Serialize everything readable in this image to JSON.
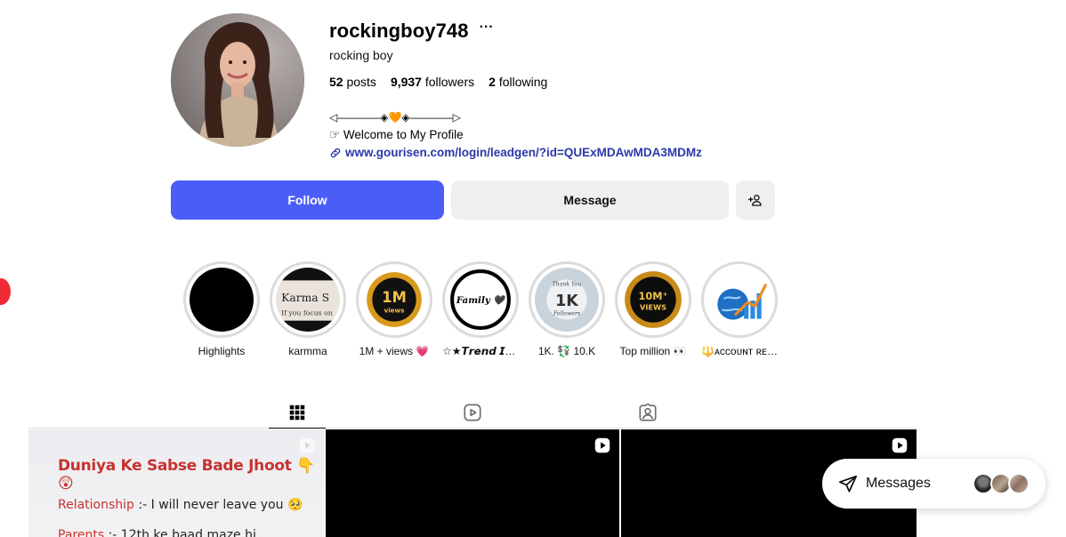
{
  "profile": {
    "username": "rockingboy748",
    "more_label": "···",
    "full_name": "rocking boy",
    "stats": {
      "posts_count": "52",
      "posts_label": "posts",
      "followers_count": "9,937",
      "followers_label": "followers",
      "following_count": "2",
      "following_label": "following"
    },
    "bio": {
      "line1": "◁————◈🧡◈————▷",
      "line2": "☞ Welcome to My Profile",
      "link": "www.gourisen.com/login/leadgen/?id=QUExMDAwMDA3MDMz"
    }
  },
  "actions": {
    "follow_label": "Follow",
    "message_label": "Message"
  },
  "highlights": [
    {
      "label": "Highlights"
    },
    {
      "label": "karmma",
      "image_text": "Karma S",
      "image_subtext": "If you focus on"
    },
    {
      "label": "1M + views 💗",
      "image_text": "1M",
      "image_subtext": "views"
    },
    {
      "label": "☆★𝙏𝙧𝙚𝙣𝙙 𝙄𝙣𝙨𝙩𝙖...",
      "image_text": "Family 🖤"
    },
    {
      "label": "1K. 💱 10.K",
      "image_text": "1K",
      "image_subtext": "Thank You",
      "image_subtext2": "Followers"
    },
    {
      "label": "Top million 👀",
      "image_text": "10M⁺",
      "image_subtext": "VIEWS"
    },
    {
      "label": "🔱ᴀᴄᴄᴏᴜɴᴛ ʀᴇᴀ..."
    }
  ],
  "tabs": [
    {
      "name": "posts",
      "icon": "grid-icon",
      "active": true
    },
    {
      "name": "reels",
      "icon": "reels-icon",
      "active": false
    },
    {
      "name": "tagged",
      "icon": "tagged-icon",
      "active": false
    }
  ],
  "posts": [
    {
      "type": "reel",
      "title": "Duniya Ke Sabse Bade Jhoot 👇😲",
      "line1_key": "Relationship",
      "line1_text": ":- I will never leave you 🥺",
      "line2_key": "Parents",
      "line2_text": ":- 12th ke baad maze hi"
    },
    {
      "type": "reel"
    },
    {
      "type": "reel"
    }
  ],
  "messages_widget": {
    "label": "Messages"
  },
  "colors": {
    "follow_button": "#4a5df9",
    "secondary_button": "#efeff2",
    "link": "#2a39a8",
    "post_title": "#c8322e"
  }
}
